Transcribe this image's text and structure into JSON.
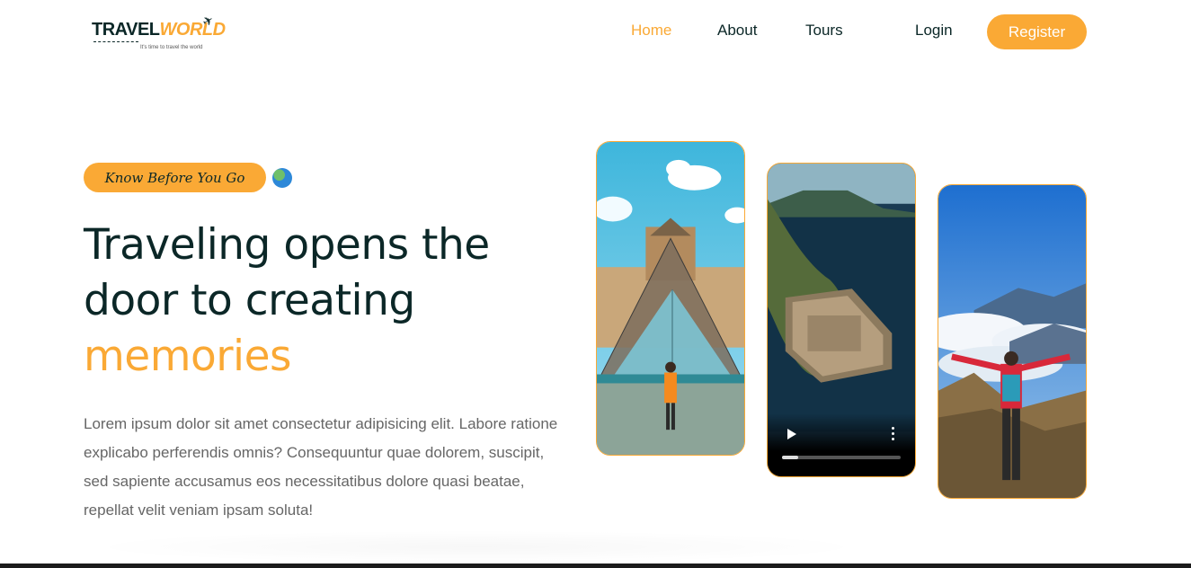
{
  "header": {
    "logo_text_1": "TRAVEL",
    "logo_text_2": "WORLD",
    "logo_tagline": "It's time to travel the world",
    "nav": [
      "Home",
      "About",
      "Tours"
    ],
    "active_nav": "Home",
    "login_label": "Login",
    "register_label": "Register"
  },
  "hero": {
    "tagline": "Know Before You Go",
    "headline_line1": "Traveling opens the",
    "headline_line2": "door to creating",
    "headline_highlight": "memories",
    "description": "Lorem ipsum dolor sit amet consectetur adipisicing elit. Labore ratione explicabo perferendis omnis? Consequuntur quae dolorem, suscipit, sed sapiente accusamus eos necessitatibus dolore quasi beatae, repellat velit veniam ipsam soluta!"
  },
  "video": {
    "progress": 0.14
  },
  "colors": {
    "accent": "#faa935",
    "heading": "#0b2727",
    "text": "#666666"
  },
  "icons": {
    "globe": "globe-icon",
    "play": "play-icon",
    "more": "more-vertical-icon",
    "plane": "plane-icon"
  }
}
